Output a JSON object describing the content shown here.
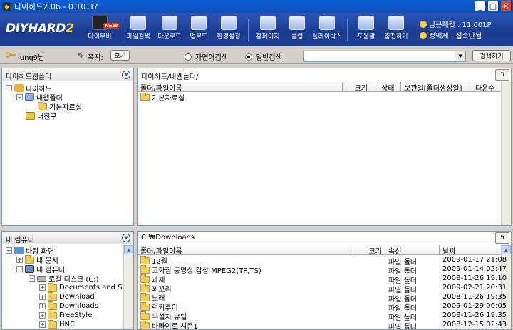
{
  "window": {
    "title": "다이하드2.0b - 0.10.37",
    "minimize": "_",
    "maximize": "□",
    "close": "×"
  },
  "logo": {
    "main": "DIYHARD",
    "suffix": "2"
  },
  "toolbar": {
    "buttons": [
      {
        "label": "다이무비",
        "badge": "NEW"
      },
      {
        "label": "파일검색"
      },
      {
        "label": "다운로드"
      },
      {
        "label": "업로드"
      },
      {
        "label": "환경설정"
      },
      {
        "label": "홈페이지"
      },
      {
        "label": "클럽"
      },
      {
        "label": "플레이박스"
      },
      {
        "label": "도움말"
      },
      {
        "label": "충전하기"
      }
    ]
  },
  "account": {
    "points_label": "남은패킷 :",
    "points_value": "11,001P",
    "plan_label": "정액제 :",
    "plan_value": "접속안됨"
  },
  "userbar": {
    "username": "jung9님",
    "memo_label": "쪽지:",
    "view_button": "보기"
  },
  "search": {
    "option_natural": "자연어검색",
    "option_normal": "일반검색",
    "query": "",
    "button": "검색하기"
  },
  "top_left": {
    "title": "다이하드웹폴더",
    "tree": [
      {
        "label": "다이하드",
        "exp": "−"
      },
      {
        "label": "내웹폴더",
        "exp": "−"
      },
      {
        "label": "기본자료실",
        "exp": ""
      },
      {
        "label": "내친구",
        "exp": ""
      }
    ]
  },
  "top_right": {
    "path": "다이하드/내웹폴더/",
    "up": "↰",
    "columns": [
      "폴더/파일이름",
      "크기",
      "상태",
      "보관일[폴더생성일]",
      "다운수"
    ],
    "rows": [
      {
        "name": "기본자료실"
      }
    ]
  },
  "bottom_left": {
    "title": "내 컴퓨터",
    "tree": [
      {
        "label": "바탕 화면",
        "exp": "−"
      },
      {
        "label": "내 문서",
        "exp": "+"
      },
      {
        "label": "내 컴퓨터",
        "exp": "−"
      },
      {
        "label": "로컬 디스크 (C:)",
        "exp": "−"
      },
      {
        "label": "Documents and Se",
        "exp": "+"
      },
      {
        "label": "Download",
        "exp": "+"
      },
      {
        "label": "Downloads",
        "exp": "+"
      },
      {
        "label": "FreeStyle",
        "exp": "+"
      },
      {
        "label": "HNC",
        "exp": "+"
      }
    ]
  },
  "bottom_right": {
    "path": "C:₩Downloads",
    "up": "↰",
    "columns": [
      "폴더/파일이름",
      "크기",
      "속성",
      "날짜"
    ],
    "rows": [
      {
        "name": "12월",
        "attr": "파일 폴더",
        "date": "2009-01-17 21:08"
      },
      {
        "name": "고화질 동영상 감상 MPEG2(TP,TS)",
        "attr": "파일 폴더",
        "date": "2009-01-14 02:47"
      },
      {
        "name": "과제",
        "attr": "파일 폴더",
        "date": "2008-11-26 19:10"
      },
      {
        "name": "꾀꼬리",
        "attr": "파일 폴더",
        "date": "2009-02-21 20:31"
      },
      {
        "name": "노래",
        "attr": "파일 폴더",
        "date": "2008-11-26 19:35"
      },
      {
        "name": "럭키루이",
        "attr": "파일 폴더",
        "date": "2009-01-29 00:05"
      },
      {
        "name": "무설치 유틸",
        "attr": "파일 폴더",
        "date": "2008-11-26 19:35"
      },
      {
        "name": "바빠이로 시즌1",
        "attr": "파일 폴더",
        "date": "2008-12-15 02:43"
      }
    ]
  },
  "colors": {
    "toolbar": "#1f47a3",
    "title": "#0a5ed8",
    "folder": "#f3cf5c"
  }
}
